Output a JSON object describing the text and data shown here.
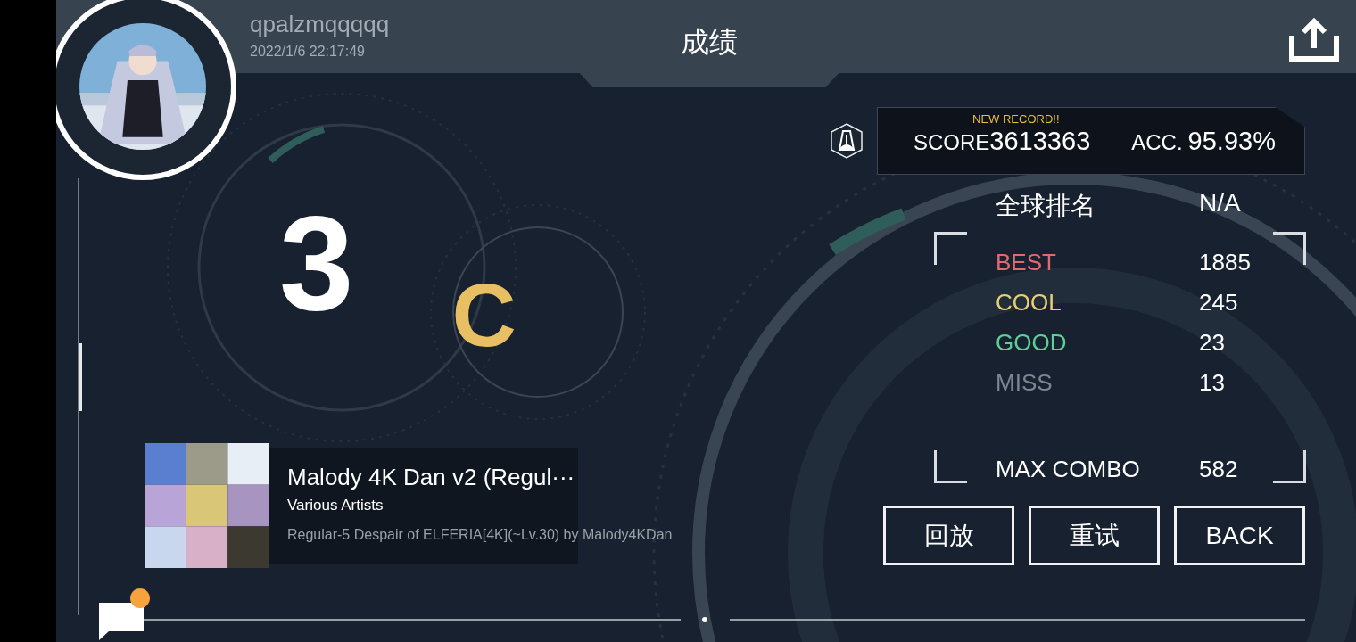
{
  "user": {
    "name": "qpalzmqqqqq",
    "timestamp": "2022/1/6 22:17:49"
  },
  "header": {
    "title": "成绩"
  },
  "rank": {
    "grade": "3",
    "sub_grade": "C"
  },
  "score": {
    "badge": "NEW RECORD!!",
    "score_label": "SCORE",
    "score": "3613363",
    "acc_label": "ACC.",
    "acc": "95.93%"
  },
  "ranking": {
    "label": "全球排名",
    "value": "N/A"
  },
  "judgements": [
    {
      "label": "BEST",
      "value": "1885",
      "color": "#e06a6e"
    },
    {
      "label": "COOL",
      "value": "245",
      "color": "#e8cf72"
    },
    {
      "label": "GOOD",
      "value": "23",
      "color": "#5fcf98"
    },
    {
      "label": "MISS",
      "value": "13",
      "color": "#7d8590"
    }
  ],
  "max_combo": {
    "label": "MAX COMBO",
    "value": "582"
  },
  "song": {
    "title": "Malody 4K Dan v2 (Regul···",
    "artist": "Various Artists",
    "chart": "Regular-5 Despair of ELFERIA[4K](~Lv.30) by Malody4KDan"
  },
  "buttons": [
    {
      "label": "回放"
    },
    {
      "label": "重试"
    },
    {
      "label": "BACK"
    }
  ],
  "chat": {
    "unread": true
  }
}
